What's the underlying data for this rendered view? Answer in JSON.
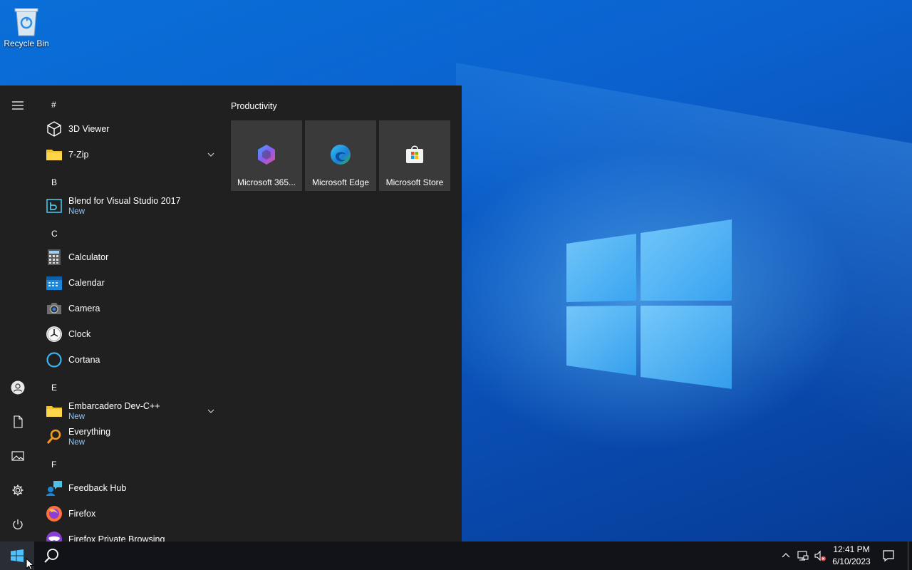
{
  "desktop": {
    "icons": [
      {
        "label": "Recycle Bin",
        "icon": "recycle-bin-icon"
      }
    ]
  },
  "start_menu": {
    "rail": [
      {
        "icon": "hamburger-menu-icon"
      },
      {
        "icon": "user-account-icon"
      },
      {
        "icon": "documents-icon"
      },
      {
        "icon": "pictures-icon"
      },
      {
        "icon": "settings-gear-icon"
      },
      {
        "icon": "power-icon"
      }
    ],
    "app_list": {
      "groups": [
        {
          "letter": "#"
        },
        {
          "letter": "B"
        },
        {
          "letter": "C"
        },
        {
          "letter": "E"
        },
        {
          "letter": "F"
        }
      ],
      "apps": [
        {
          "name": "3D Viewer",
          "icon": "cube-icon"
        },
        {
          "name": "7-Zip",
          "icon": "folder-icon",
          "expandable": true
        },
        {
          "name": "Blend for Visual Studio 2017",
          "badge": "New",
          "icon": "blend-icon"
        },
        {
          "name": "Calculator",
          "icon": "calculator-icon"
        },
        {
          "name": "Calendar",
          "icon": "calendar-icon"
        },
        {
          "name": "Camera",
          "icon": "camera-icon"
        },
        {
          "name": "Clock",
          "icon": "clock-icon"
        },
        {
          "name": "Cortana",
          "icon": "cortana-icon"
        },
        {
          "name": "Embarcadero Dev-C++",
          "badge": "New",
          "icon": "folder-icon",
          "expandable": true
        },
        {
          "name": "Everything",
          "badge": "New",
          "icon": "magnifier-icon"
        },
        {
          "name": "Feedback Hub",
          "icon": "feedback-hub-icon"
        },
        {
          "name": "Firefox",
          "icon": "firefox-icon"
        },
        {
          "name": "Firefox Private Browsing",
          "icon": "firefox-private-icon"
        }
      ]
    },
    "tiles": {
      "group_title": "Productivity",
      "items": [
        {
          "label": "Microsoft 365...",
          "icon": "microsoft-365-icon"
        },
        {
          "label": "Microsoft Edge",
          "icon": "edge-icon"
        },
        {
          "label": "Microsoft Store",
          "icon": "store-icon"
        }
      ]
    }
  },
  "taskbar": {
    "start_icon": "windows-start-icon",
    "search_icon": "search-icon",
    "tray": {
      "icons": [
        "chevron-up-icon",
        "network-icon",
        "volume-muted-icon",
        "notification-icon"
      ],
      "time": "12:41 PM",
      "date": "6/10/2023"
    }
  },
  "colors": {
    "start_bg": "#202020",
    "tile_bg": "#3a3a3a",
    "taskbar_bg": "#111318",
    "new_badge": "#8cc8ff"
  }
}
